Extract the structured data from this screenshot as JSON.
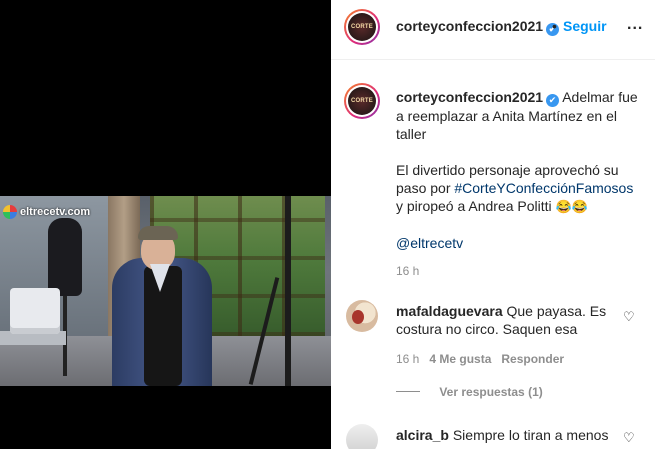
{
  "media": {
    "watermark": "eltrecetv.com"
  },
  "header": {
    "username": "corteyconfeccion2021",
    "verified_glyph": "✔",
    "separator": "•",
    "follow_label": "Seguir",
    "more_label": "...",
    "avatar_text": "CORTE"
  },
  "caption": {
    "username": "corteyconfeccion2021",
    "line1": "Adelmar fue a reemplazar a Anita Martínez en el taller",
    "line2_pre": "El divertido personaje aprovechó su paso por ",
    "hashtag": "#CorteYConfecciónFamosos",
    "line2_post": " y piropeó a Andrea Politti ",
    "emojis": "😂😂",
    "mention": "@eltrecetv",
    "time": "16 h"
  },
  "comments": [
    {
      "username": "mafaldaguevara",
      "text": "Que payasa. Es costura no circo. Saquen esa",
      "time": "16 h",
      "likes": "4 Me gusta",
      "reply_label": "Responder",
      "view_replies": "Ver respuestas (1)"
    },
    {
      "username": "alcira_b",
      "text": "Siempre lo tiran a menos"
    }
  ],
  "icons": {
    "heart": "♡"
  },
  "colors": {
    "link_blue": "#0095f6",
    "hashtag": "#00376b",
    "muted": "#8e8e8e",
    "text": "#262626"
  }
}
